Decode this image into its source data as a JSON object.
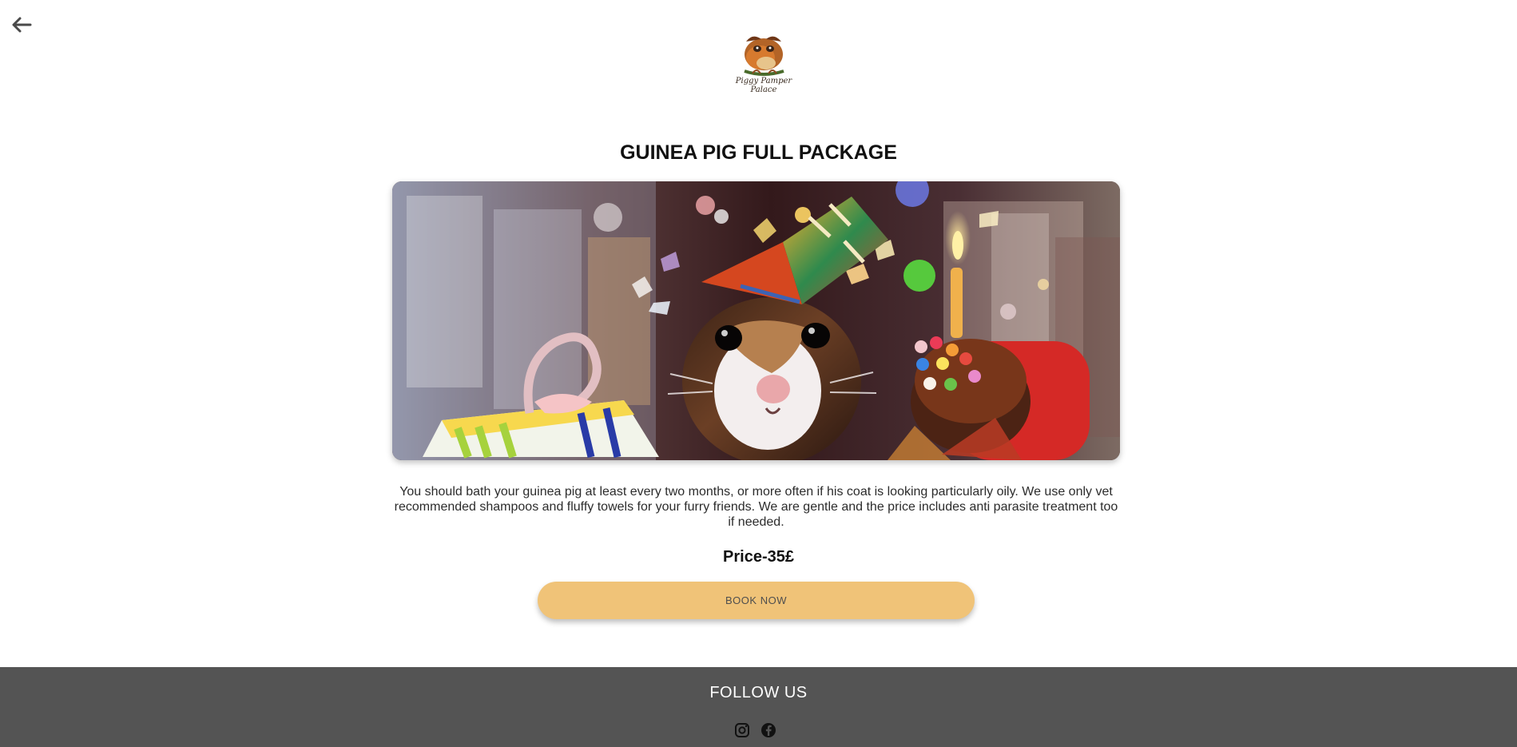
{
  "navigation": {
    "back_icon": "arrow-left-icon"
  },
  "brand": {
    "logo_icon": "guinea-pig-logo-icon",
    "logo_text_line_1": "Piggy Pamper",
    "logo_text_line_2": "Palace"
  },
  "service": {
    "title": "GUINEA PIG FULL PACKAGE",
    "description": "You should bath your guinea pig at least every two months, or more often if his coat is looking particularly oily. We use only vet recommended shampoos and fluffy towels for your furry friends. We are gentle and the price includes anti parasite treatment too if needed.",
    "price": "Price-35£",
    "book_label": "BOOK NOW"
  },
  "footer": {
    "title": "FOLLOW US",
    "social_icons": [
      "instagram-icon",
      "facebook-icon"
    ]
  },
  "colors": {
    "button": "#f0c378",
    "footer": "#545454",
    "white": "#ffffff"
  }
}
